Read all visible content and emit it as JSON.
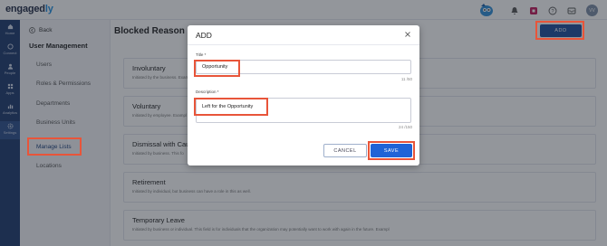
{
  "app": {
    "logo_main": "engaged",
    "logo_accent": "ly"
  },
  "topbar": {
    "icons": [
      "mascot-icon",
      "bell-icon",
      "app-badge-icon",
      "help-icon",
      "inbox-icon"
    ],
    "avatar_initials": "VV"
  },
  "leftnav": {
    "items": [
      {
        "label": "Home",
        "icon": "home-icon"
      },
      {
        "label": "Connect",
        "icon": "connect-icon"
      },
      {
        "label": "People",
        "icon": "people-icon"
      },
      {
        "label": "Apps",
        "icon": "apps-icon"
      },
      {
        "label": "Analytics",
        "icon": "analytics-icon"
      },
      {
        "label": "Settings",
        "icon": "settings-icon"
      }
    ]
  },
  "subnav": {
    "back_label": "Back",
    "section_title": "User Management",
    "items": [
      "Users",
      "Roles & Permissions",
      "Departments",
      "Business Units",
      "Manage Lists",
      "Locations"
    ],
    "active_item": "Manage Lists"
  },
  "main": {
    "page_title": "Blocked Reason",
    "add_label": "ADD",
    "cards": [
      {
        "title": "Involuntary",
        "desc": "Initiated by the business. Exam"
      },
      {
        "title": "Voluntary",
        "desc": "Initiated by employee. Exampl"
      },
      {
        "title": "Dismissal with Cause",
        "desc": "Initiated by business. This fo"
      },
      {
        "title": "Retirement",
        "desc": "Initiated by individual, but business can have a role in this as well."
      },
      {
        "title": "Temporary Leave",
        "desc": "Initiated by business or individual. This field is for individuals that the organization may potentially want to work with again in the future. Exampl"
      }
    ]
  },
  "modal": {
    "title": "ADD",
    "title_field_label": "Title *",
    "title_value": "Opportunity",
    "title_counter": "11 /50",
    "desc_field_label": "Description *",
    "desc_value": "Left for the Opportunity",
    "desc_counter": "24 /150",
    "cancel_label": "CANCEL",
    "save_label": "SAVE"
  },
  "colors": {
    "nav_bg": "#1e3a6e",
    "primary": "#1f63d6",
    "highlight": "#e8553a"
  }
}
